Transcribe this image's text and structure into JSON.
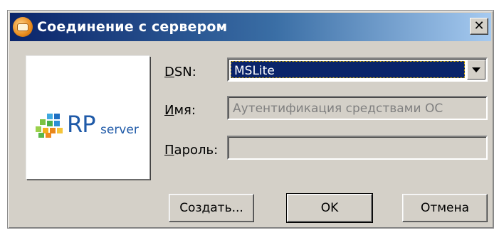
{
  "window": {
    "title": "Соединение с сервером",
    "close_glyph": "✕"
  },
  "logo": {
    "main": "RP",
    "sub": "server"
  },
  "form": {
    "dsn_label_mnemonic": "D",
    "dsn_label_rest": "SN:",
    "dsn_value": "MSLite",
    "name_label_mnemonic": "И",
    "name_label_rest": "мя:",
    "name_value": "Аутентификация средствами ОС",
    "password_label_mnemonic": "П",
    "password_label_rest": "ароль:",
    "password_value": ""
  },
  "buttons": {
    "create": "Создать...",
    "ok": "OK",
    "cancel": "Отмена"
  },
  "colors": {
    "title_start": "#0a246a",
    "title_end": "#a6caf0",
    "selection": "#0a246a",
    "face": "#d4d0c8"
  }
}
